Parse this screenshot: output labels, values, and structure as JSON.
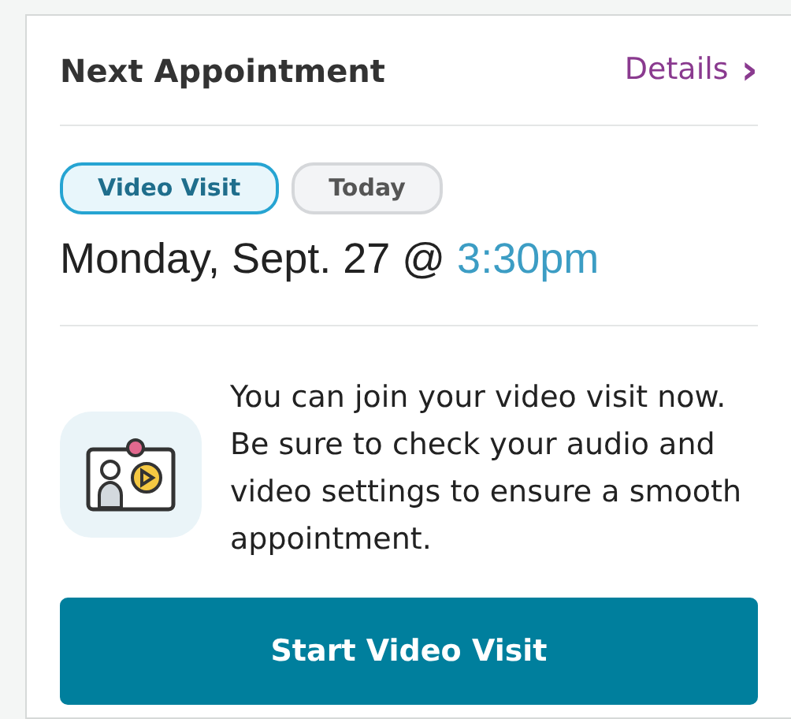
{
  "card": {
    "title": "Next Appointment",
    "link": {
      "label": "Details",
      "chevron": "›"
    }
  },
  "tags": [
    {
      "label": "Video Visit",
      "kind": "type"
    },
    {
      "label": "Today",
      "kind": "day"
    }
  ],
  "date": {
    "day": "Monday, Sept. 27 @ ",
    "time": "3:30pm"
  },
  "message": "You can join your video visit now. Be sure to check your audio and video settings to ensure a smooth appointment.",
  "button": "Start Video Visit"
}
